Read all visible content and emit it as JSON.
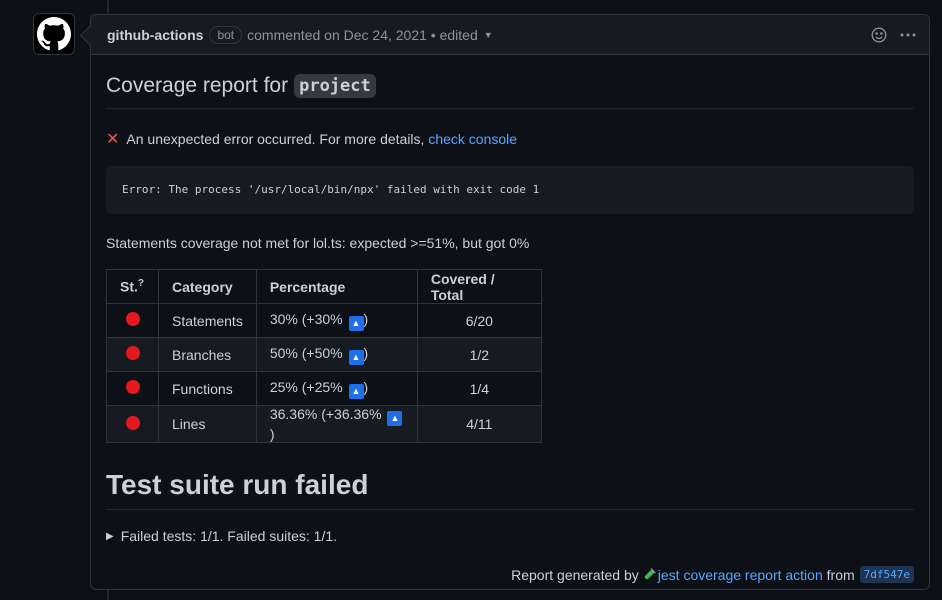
{
  "header": {
    "author": "github-actions",
    "bot_label": "bot",
    "meta": "commented on Dec 24, 2021 • edited"
  },
  "report": {
    "title_prefix": "Coverage report for",
    "title_code": "project",
    "error_text": "An unexpected error occurred. For more details,",
    "error_link": "check console",
    "error_box": "Error: The process '/usr/local/bin/npx' failed with exit code 1",
    "stmt_msg": "Statements coverage not met for lol.ts: expected >=51%, but got 0%"
  },
  "table": {
    "headers": [
      "St.",
      "?",
      "Category",
      "Percentage",
      "Covered / Total"
    ],
    "rows": [
      {
        "category": "Statements",
        "percentage": "30% (+30%",
        "covered": "6/20"
      },
      {
        "category": "Branches",
        "percentage": "50% (+50%",
        "covered": "1/2"
      },
      {
        "category": "Functions",
        "percentage": "25% (+25%",
        "covered": "1/4"
      },
      {
        "category": "Lines",
        "percentage": "36.36% (+36.36%",
        "covered": "4/11"
      }
    ],
    "close_paren": ")"
  },
  "suite": {
    "title": "Test suite run failed",
    "details": "Failed tests: 1/1. Failed suites: 1/1."
  },
  "footer": {
    "prefix": "Report generated by",
    "link": "jest coverage report action",
    "from": "from",
    "sha": "7df547e"
  },
  "icons": {
    "status_color": "#e5181e",
    "accent": "#58a6ff"
  }
}
